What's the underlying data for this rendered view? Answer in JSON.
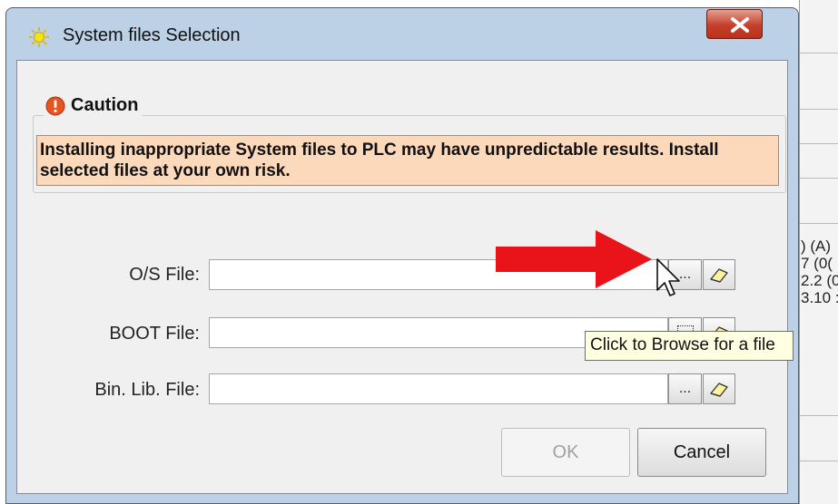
{
  "window": {
    "title": "System files Selection",
    "close_glyph": "x"
  },
  "caution": {
    "title": "Caution",
    "message": "Installing inappropriate System files to PLC may have unpredictable results. Install selected files at your own risk."
  },
  "files": {
    "os": {
      "label": "O/S File:",
      "value": "",
      "browse_label": "..."
    },
    "boot": {
      "label": "BOOT File:",
      "value": "",
      "browse_label": ""
    },
    "binlib": {
      "label": "Bin. Lib. File:",
      "value": "",
      "browse_label": "..."
    }
  },
  "tooltip": "Click to Browse for a file",
  "buttons": {
    "ok": "OK",
    "cancel": "Cancel"
  },
  "background_app_text": ") (A)\n7 (0(\n2.2 (0\n3.10 :",
  "colors": {
    "caution_bg": "#fcd9bb",
    "arrow": "#e8141a",
    "close_button": "#c4402a",
    "tooltip_bg": "#ffffe1"
  }
}
